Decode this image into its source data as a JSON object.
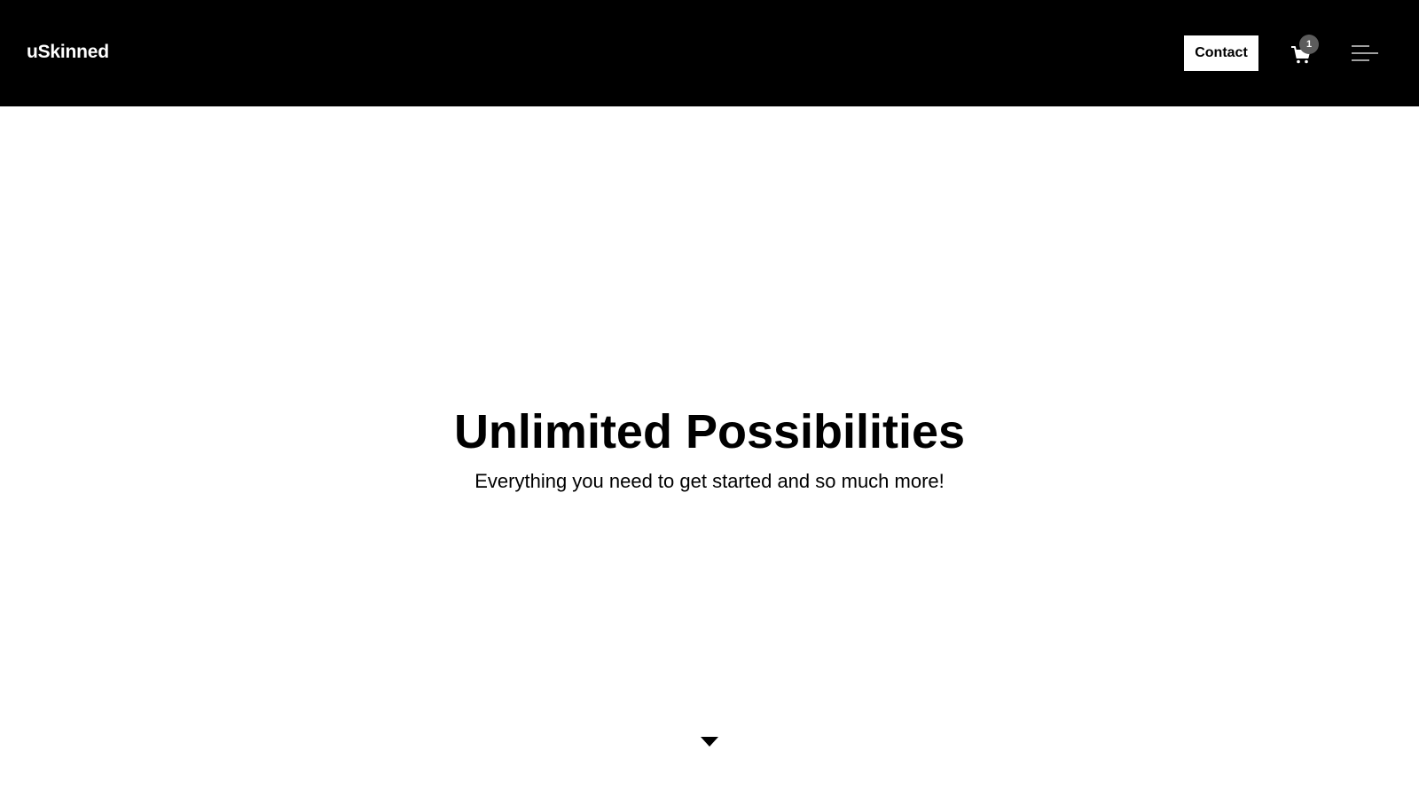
{
  "header": {
    "logo_text": "uSkinned",
    "contact_label": "Contact",
    "cart": {
      "icon": "shopping-cart-icon",
      "count": "1"
    },
    "menu": {
      "icon": "hamburger-menu-icon"
    }
  },
  "hero": {
    "title": "Unlimited Possibilities",
    "subtitle": "Everything you need to get started and so much more!",
    "scroll_icon": "caret-down-icon"
  },
  "colors": {
    "header_bg": "#000000",
    "page_bg": "#ffffff",
    "badge_bg": "#5c5c5c"
  }
}
